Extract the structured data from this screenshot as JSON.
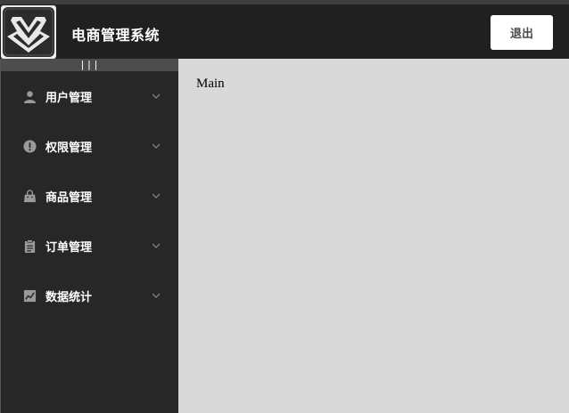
{
  "header": {
    "title": "电商管理系统",
    "logout_label": "退出",
    "logo_icon": "chevron-diamond-logo-icon"
  },
  "sidebar": {
    "collapse_label": "|||",
    "items": [
      {
        "label": "用户管理",
        "icon": "user-icon"
      },
      {
        "label": "权限管理",
        "icon": "exclamation-icon"
      },
      {
        "label": "商品管理",
        "icon": "shopping-bag-icon"
      },
      {
        "label": "订单管理",
        "icon": "clipboard-icon"
      },
      {
        "label": "数据统计",
        "icon": "chart-icon"
      }
    ]
  },
  "main": {
    "label": "Main"
  },
  "colors": {
    "header_bg": "#202020",
    "sidebar_bg": "#272727",
    "collapse_bg": "#4d4d4d",
    "main_bg": "#d9d9d9",
    "icon_gray": "#9a9a9a"
  }
}
